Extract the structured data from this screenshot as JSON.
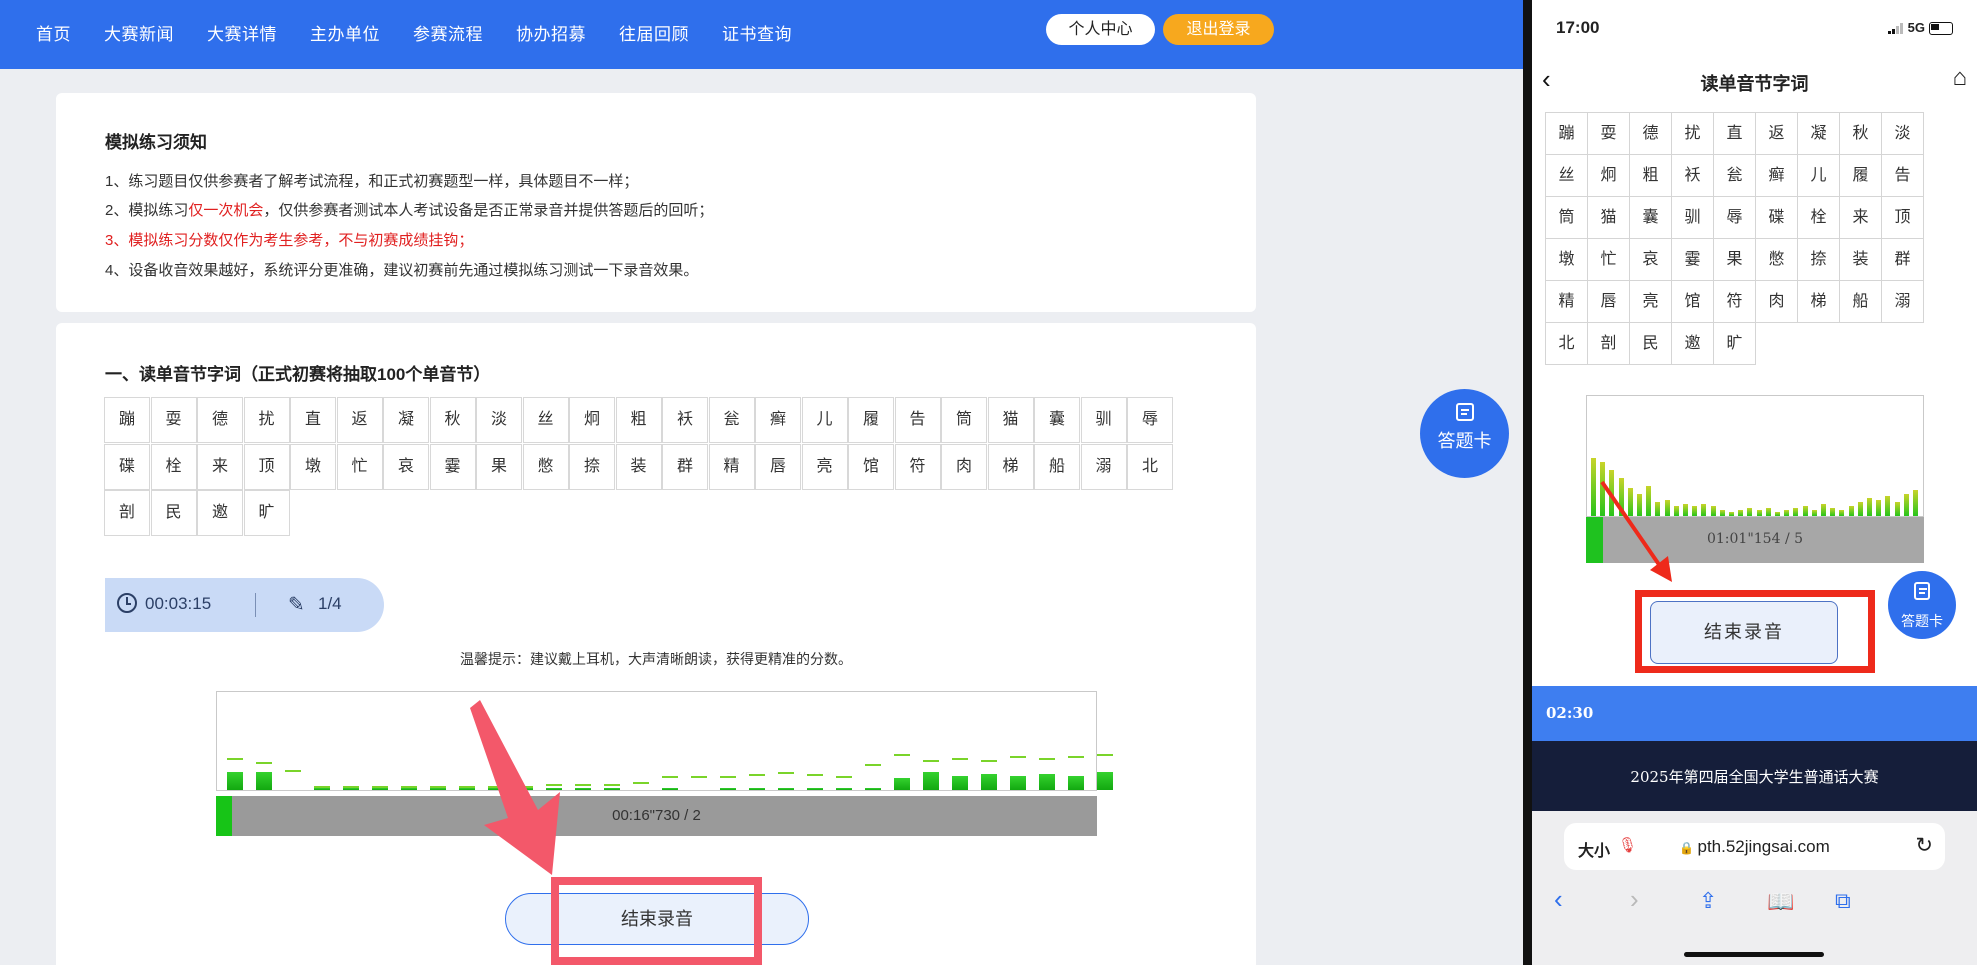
{
  "nav": {
    "items": [
      "首页",
      "大赛新闻",
      "大赛详情",
      "主办单位",
      "参赛流程",
      "协办招募",
      "往届回顾",
      "证书查询"
    ],
    "user_center": "个人中心",
    "logout": "退出登录"
  },
  "notice": {
    "title": "模拟练习须知",
    "line1": "1、练习题目仅供参赛者了解考试流程，和正式初赛题型一样，具体题目不一样；",
    "line2_pre": "2、模拟练习",
    "line2_red": "仅一次机会",
    "line2_post": "，仅供参赛者测试本人考试设备是否正常录音并提供答题后的回听；",
    "line3": "3、模拟练习分数仅作为考生参考，不与初赛成绩挂钩；",
    "line4": "4、设备收音效果越好，系统评分更准确，建议初赛前先通过模拟练习测试一下录音效果。"
  },
  "section": {
    "title": "一、读单音节字词（正式初赛将抽取100个单音节）",
    "characters": [
      "蹦",
      "耍",
      "德",
      "扰",
      "直",
      "返",
      "凝",
      "秋",
      "淡",
      "丝",
      "炯",
      "粗",
      "袄",
      "瓮",
      "癣",
      "儿",
      "履",
      "告",
      "筒",
      "猫",
      "囊",
      "驯",
      "辱",
      "碟",
      "栓",
      "来",
      "顶",
      "墩",
      "忙",
      "哀",
      "霎",
      "果",
      "憋",
      "捺",
      "装",
      "群",
      "精",
      "唇",
      "亮",
      "馆",
      "符",
      "肉",
      "梯",
      "船",
      "溺",
      "北",
      "剖",
      "民",
      "邀",
      "旷"
    ],
    "timer": "00:03:15",
    "progress": "1/4",
    "tip": "温馨提示：建议戴上耳机，大声清晰朗读，获得更精准的分数。",
    "record_status": "00:16\"730 / 2",
    "stop_button": "结束录音",
    "answer_card": "答题卡"
  },
  "colors": {
    "primary": "#2f6fec",
    "logout_orange": "#f7a81e",
    "highlight_red": "#f3586a",
    "notice_red": "#e02020"
  },
  "phone": {
    "status_time": "17:00",
    "network": "5G",
    "title": "读单音节字词",
    "characters": [
      "蹦",
      "耍",
      "德",
      "扰",
      "直",
      "返",
      "凝",
      "秋",
      "淡",
      "丝",
      "炯",
      "粗",
      "袄",
      "瓮",
      "癣",
      "儿",
      "履",
      "告",
      "筒",
      "猫",
      "囊",
      "驯",
      "辱",
      "碟",
      "栓",
      "来",
      "顶",
      "墩",
      "忙",
      "哀",
      "霎",
      "果",
      "憋",
      "捺",
      "装",
      "群",
      "精",
      "唇",
      "亮",
      "馆",
      "符",
      "肉",
      "梯",
      "船",
      "溺",
      "北",
      "剖",
      "民",
      "邀",
      "旷"
    ],
    "record_status": "01:01\"154 / 5",
    "stop_button": "结束录音",
    "answer_card": "答题卡",
    "countdown": "02:30",
    "footer": "2025年第四届全国大学生普通话大赛",
    "text_size": "大小",
    "url": "pth.52jingsai.com"
  }
}
